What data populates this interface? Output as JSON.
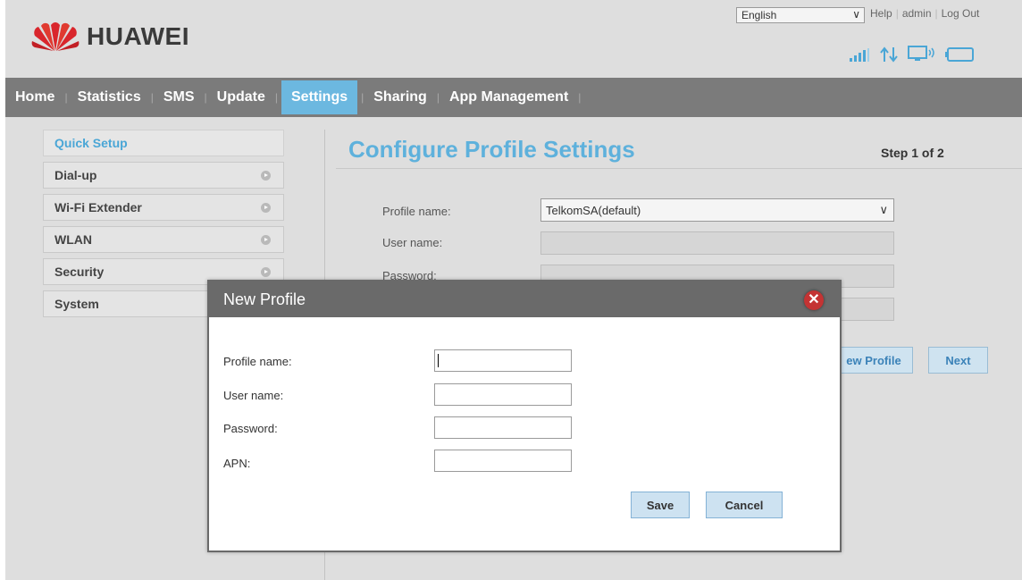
{
  "header": {
    "brand": "HUAWEI",
    "language": "English",
    "links": [
      "Help",
      "admin",
      "Log Out"
    ]
  },
  "icons": [
    "huawei-logo",
    "signal-icon",
    "data-transfer-icon",
    "monitor-icon",
    "battery-icon"
  ],
  "nav": {
    "items": [
      "Home",
      "Statistics",
      "SMS",
      "Update",
      "Settings",
      "Sharing",
      "App Management"
    ],
    "active": "Settings"
  },
  "sidebar": {
    "items": [
      "Quick Setup",
      "Dial-up",
      "Wi-Fi Extender",
      "WLAN",
      "Security",
      "System"
    ],
    "active": "Quick Setup"
  },
  "main": {
    "title": "Configure Profile Settings",
    "step": "Step 1 of 2",
    "labels": {
      "profile_name": "Profile name:",
      "user_name": "User name:",
      "password": "Password:"
    },
    "profile_value": "TelkomSA(default)",
    "new_profile_button": "ew Profile",
    "next_button": "Next"
  },
  "modal": {
    "title": "New Profile",
    "labels": {
      "profile_name": "Profile name:",
      "user_name": "User name:",
      "password": "Password:",
      "apn": "APN:"
    },
    "save": "Save",
    "cancel": "Cancel"
  },
  "colors": {
    "accent": "#5eb1dc",
    "nav_bg": "#7b7b7b",
    "nav_active": "#6cb8e0",
    "page_bg": "#dedede",
    "brand_red": "#d9262c"
  }
}
